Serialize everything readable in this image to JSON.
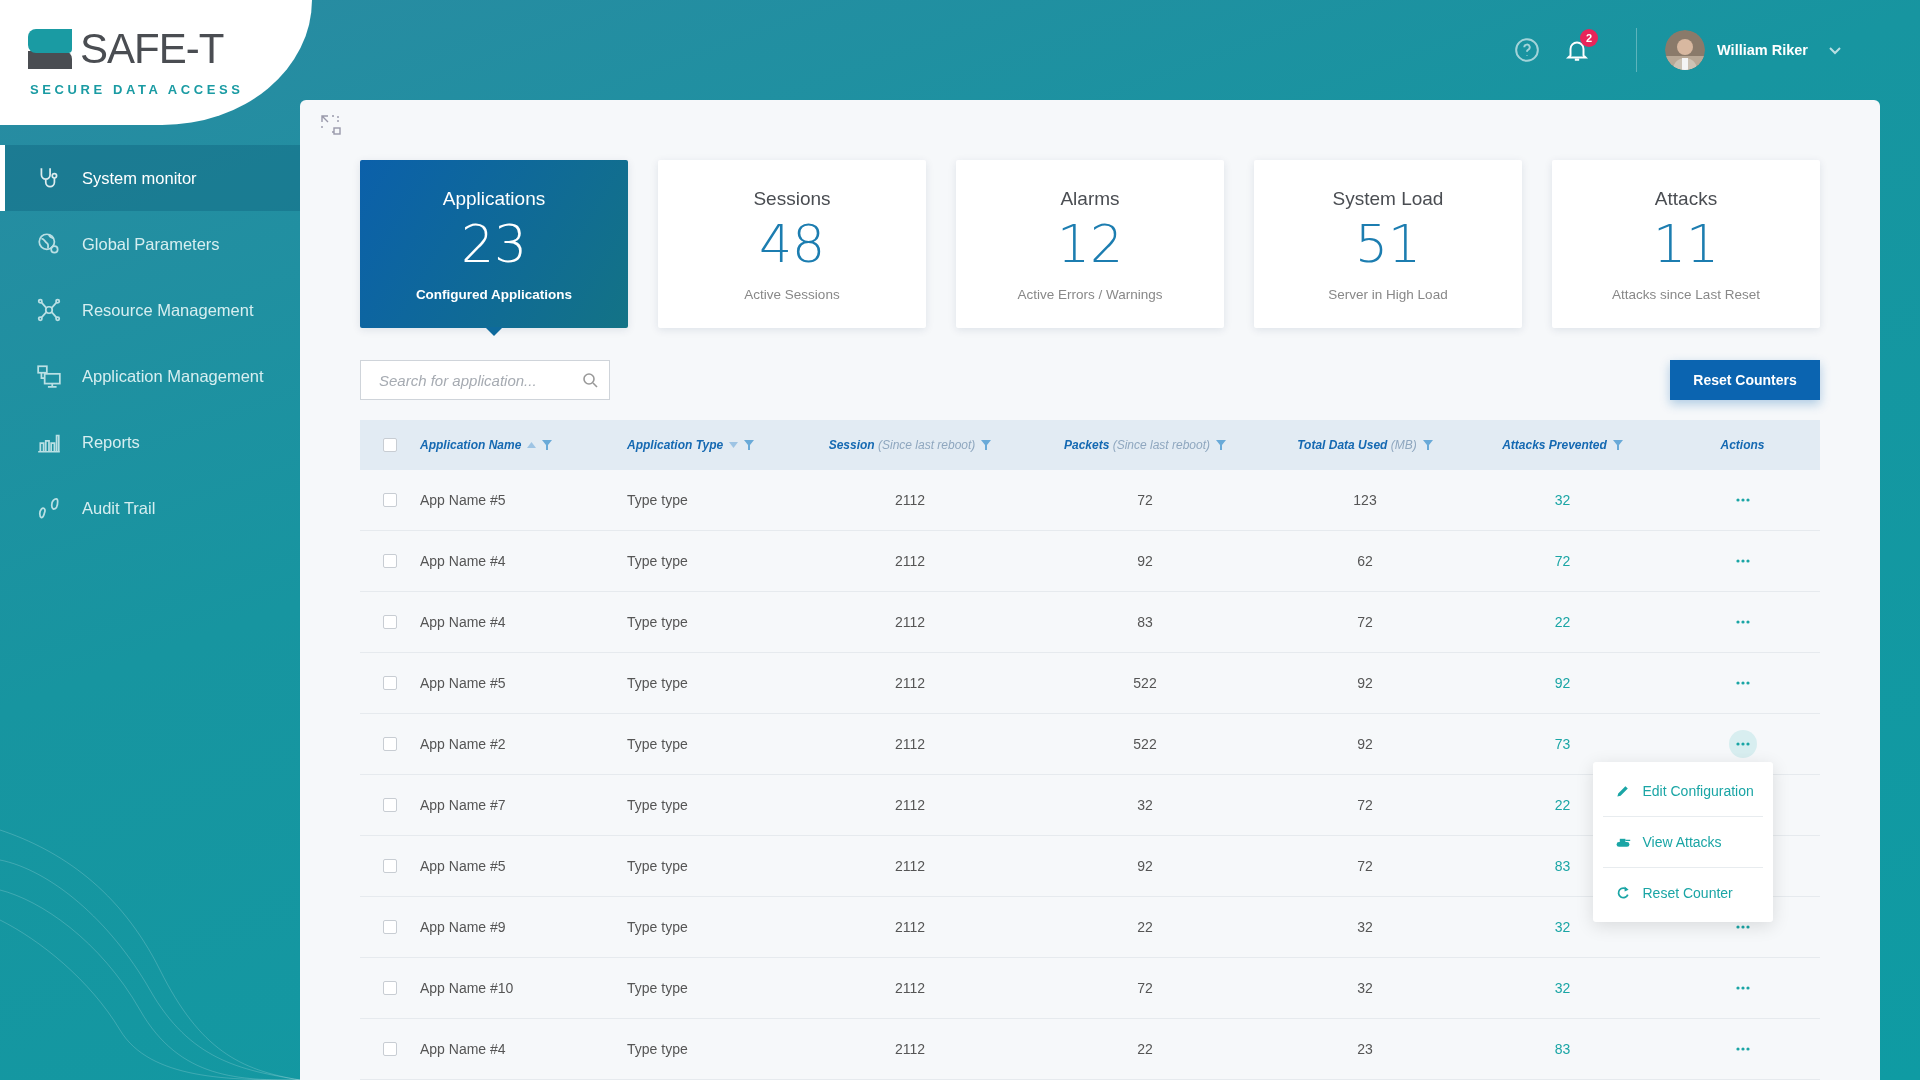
{
  "logo": {
    "name": "SAFE-T",
    "tagline": "SECURE DATA ACCESS"
  },
  "sidebar": {
    "items": [
      {
        "label": "System monitor",
        "selected": true
      },
      {
        "label": "Global Parameters",
        "selected": false
      },
      {
        "label": "Resource Management",
        "selected": false
      },
      {
        "label": "Application Management",
        "selected": false
      },
      {
        "label": "Reports",
        "selected": false
      },
      {
        "label": "Audit Trail",
        "selected": false
      }
    ]
  },
  "topbar": {
    "notifications_count": "2",
    "user_name": "William Riker"
  },
  "cards": [
    {
      "title": "Applications",
      "value": "23",
      "caption": "Configured Applications",
      "selected": true
    },
    {
      "title": "Sessions",
      "value": "48",
      "caption": "Active Sessions",
      "selected": false
    },
    {
      "title": "Alarms",
      "value": "12",
      "caption": "Active Errors / Warnings",
      "selected": false
    },
    {
      "title": "System Load",
      "value": "51",
      "caption": "Server in High Load",
      "selected": false
    },
    {
      "title": "Attacks",
      "value": "11",
      "caption": "Attacks since Last Reset",
      "selected": false
    }
  ],
  "search": {
    "placeholder": "Search for application..."
  },
  "reset_button": "Reset Counters",
  "table": {
    "select_all": {
      "checked": false
    },
    "columns": [
      {
        "label": "Application Name",
        "sorted": true,
        "descending": false,
        "filter": true
      },
      {
        "label": "Application Type",
        "sorted": true,
        "descending": true,
        "filter": true
      },
      {
        "label": "Session",
        "note": "(Since last reboot)",
        "sorted": false,
        "filter": true
      },
      {
        "label": "Packets",
        "note": "(Since last reboot)",
        "sorted": false,
        "filter": true
      },
      {
        "label": "Total Data Used",
        "note": "(MB)",
        "sorted": false,
        "filter": true
      },
      {
        "label": "Attacks Prevented",
        "sorted": false,
        "filter": true
      },
      {
        "label": "Actions",
        "sorted": false,
        "filter": false
      }
    ],
    "rows": [
      {
        "checked": false,
        "cells": [
          "App Name #5",
          "Type type",
          "2112",
          "72",
          "123",
          "32"
        ],
        "menu_open": false
      },
      {
        "checked": false,
        "cells": [
          "App Name #4",
          "Type type",
          "2112",
          "92",
          "62",
          "72"
        ],
        "menu_open": false
      },
      {
        "checked": false,
        "cells": [
          "App Name #4",
          "Type type",
          "2112",
          "83",
          "72",
          "22"
        ],
        "menu_open": false
      },
      {
        "checked": false,
        "cells": [
          "App Name #5",
          "Type type",
          "2112",
          "522",
          "92",
          "92"
        ],
        "menu_open": false
      },
      {
        "checked": false,
        "cells": [
          "App Name #2",
          "Type type",
          "2112",
          "522",
          "92",
          "73"
        ],
        "menu_open": true
      },
      {
        "checked": false,
        "cells": [
          "App Name #7",
          "Type type",
          "2112",
          "32",
          "72",
          "22"
        ],
        "menu_open": false
      },
      {
        "checked": false,
        "cells": [
          "App Name #5",
          "Type type",
          "2112",
          "92",
          "72",
          "83"
        ],
        "menu_open": false
      },
      {
        "checked": false,
        "cells": [
          "App Name #9",
          "Type type",
          "2112",
          "22",
          "32",
          "32"
        ],
        "menu_open": false
      },
      {
        "checked": false,
        "cells": [
          "App Name #10",
          "Type type",
          "2112",
          "72",
          "32",
          "32"
        ],
        "menu_open": false
      },
      {
        "checked": false,
        "cells": [
          "App Name #4",
          "Type type",
          "2112",
          "22",
          "23",
          "83"
        ],
        "menu_open": false
      }
    ]
  },
  "action_menu": {
    "items": [
      "Edit Configuration",
      "View Attacks",
      "Reset Counter"
    ]
  }
}
